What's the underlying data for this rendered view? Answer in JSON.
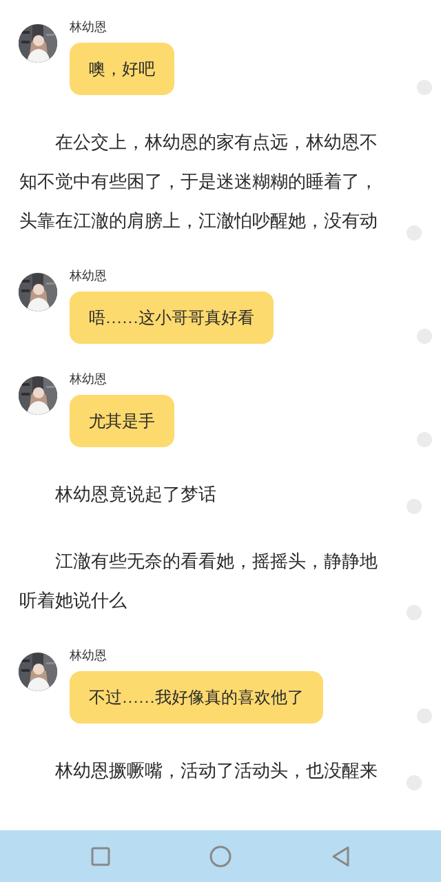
{
  "blocks": [
    {
      "kind": "message",
      "sender": "林幼恩",
      "text": "噢，好吧"
    },
    {
      "kind": "paragraph",
      "text": "在公交上，林幼恩的家有点远，林幼恩不知不觉中有些困了，于是迷迷糊糊的睡着了，头靠在江澈的肩膀上，江澈怕吵醒她，没有动"
    },
    {
      "kind": "message",
      "sender": "林幼恩",
      "text": "唔……这小哥哥真好看"
    },
    {
      "kind": "message",
      "sender": "林幼恩",
      "text": "尤其是手"
    },
    {
      "kind": "paragraph",
      "text": "林幼恩竟说起了梦话"
    },
    {
      "kind": "paragraph",
      "text": "江澈有些无奈的看看她，摇摇头，静静地听着她说什么"
    },
    {
      "kind": "message",
      "sender": "林幼恩",
      "text": "不过……我好像真的喜欢他了"
    },
    {
      "kind": "paragraph",
      "text": "林幼恩撅噘嘴，活动了活动头，也没醒来"
    }
  ]
}
